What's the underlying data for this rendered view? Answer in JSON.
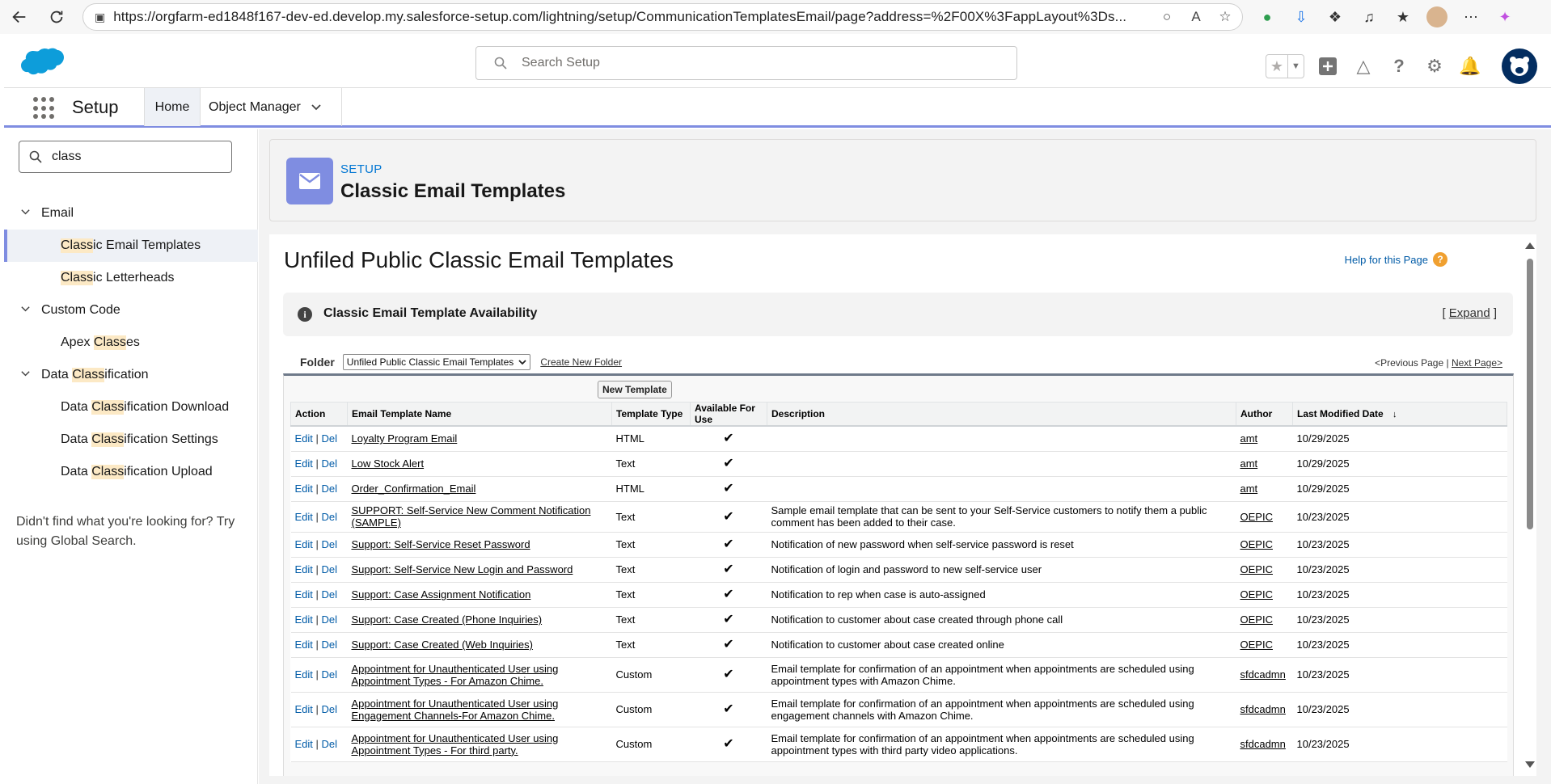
{
  "browser": {
    "url": "https://orgfarm-ed1848f167-dev-ed.develop.my.salesforce-setup.com/lightning/setup/CommunicationTemplatesEmail/page?address=%2F00X%3FappLayout%3Ds..."
  },
  "header": {
    "search_placeholder": "Search Setup"
  },
  "nav": {
    "app_name": "Setup",
    "tabs": [
      {
        "label": "Home"
      },
      {
        "label": "Object Manager"
      }
    ]
  },
  "sidebar": {
    "quickfind_value": "class",
    "groups": [
      {
        "label": "Email",
        "items": [
          {
            "pre": "",
            "hl": "Class",
            "post": "ic Email Templates"
          },
          {
            "pre": "",
            "hl": "Class",
            "post": "ic Letterheads"
          }
        ]
      },
      {
        "label": "Custom Code",
        "items": [
          {
            "pre": "Apex ",
            "hl": "Class",
            "post": "es"
          }
        ]
      },
      {
        "label_pre": "Data ",
        "label_hl": "Class",
        "label_post": "ification",
        "items": [
          {
            "pre": "Data ",
            "hl": "Class",
            "post": "ification Download"
          },
          {
            "pre": "Data ",
            "hl": "Class",
            "post": "ification Settings"
          },
          {
            "pre": "Data ",
            "hl": "Class",
            "post": "ification Upload"
          }
        ]
      }
    ],
    "not_found": "Didn't find what you're looking for? Try using Global Search."
  },
  "page_header": {
    "eyebrow": "SETUP",
    "title": "Classic Email Templates"
  },
  "content": {
    "title": "Unfiled Public Classic Email Templates",
    "help_link": "Help for this Page",
    "availability_title": "Classic Email Template Availability",
    "expand_open": "[ ",
    "expand_label": "Expand",
    "expand_close": " ]",
    "folder_label": "Folder",
    "folder_value": "Unfiled Public Classic Email Templates",
    "create_folder": "Create New Folder",
    "prev_page": "<Previous Page",
    "pager_sep": " | ",
    "next_page": "Next Page>",
    "new_template": "New Template"
  },
  "table": {
    "headers": {
      "action": "Action",
      "name": "Email Template Name",
      "type": "Template Type",
      "available": "Available For Use",
      "description": "Description",
      "author": "Author",
      "modified": "Last Modified Date"
    },
    "edit_label": "Edit",
    "del_label": "Del",
    "rows": [
      {
        "name": "Loyalty Program Email",
        "type": "HTML",
        "available": "✔",
        "description": "",
        "author": "amt",
        "modified": "10/29/2025"
      },
      {
        "name": "Low Stock Alert",
        "type": "Text",
        "available": "✔",
        "description": "",
        "author": "amt",
        "modified": "10/29/2025"
      },
      {
        "name": "Order_Confirmation_Email",
        "type": "HTML",
        "available": "✔",
        "description": "",
        "author": "amt",
        "modified": "10/29/2025"
      },
      {
        "name": "SUPPORT: Self-Service New Comment Notification (SAMPLE)",
        "type": "Text",
        "available": "✔",
        "description": "Sample email template that can be sent to your Self-Service customers to notify them a public comment has been added to their case.",
        "author": "OEPIC",
        "modified": "10/23/2025"
      },
      {
        "name": "Support: Self-Service Reset Password",
        "type": "Text",
        "available": "✔",
        "description": "Notification of new password when self-service password is reset",
        "author": "OEPIC",
        "modified": "10/23/2025"
      },
      {
        "name": "Support: Self-Service New Login and Password",
        "type": "Text",
        "available": "✔",
        "description": "Notification of login and password to new self-service user",
        "author": "OEPIC",
        "modified": "10/23/2025"
      },
      {
        "name": "Support: Case Assignment Notification",
        "type": "Text",
        "available": "✔",
        "description": "Notification to rep when case is auto-assigned",
        "author": "OEPIC",
        "modified": "10/23/2025"
      },
      {
        "name": "Support: Case Created (Phone Inquiries)",
        "type": "Text",
        "available": "✔",
        "description": "Notification to customer about case created through phone call",
        "author": "OEPIC",
        "modified": "10/23/2025"
      },
      {
        "name": "Support: Case Created (Web Inquiries)",
        "type": "Text",
        "available": "✔",
        "description": "Notification to customer about case created online",
        "author": "OEPIC",
        "modified": "10/23/2025"
      },
      {
        "name": "Appointment for Unauthenticated User using Appointment Types - For Amazon Chime.",
        "type": "Custom",
        "available": "✔",
        "description": "Email template for confirmation of an appointment when appointments are scheduled using appointment types with Amazon Chime.",
        "author": "sfdcadmn",
        "modified": "10/23/2025"
      },
      {
        "name": "Appointment for Unauthenticated User using Engagement Channels-For Amazon Chime.",
        "type": "Custom",
        "available": "✔",
        "description": "Email template for confirmation of an appointment when appointments are scheduled using engagement channels with Amazon Chime.",
        "author": "sfdcadmn",
        "modified": "10/23/2025"
      },
      {
        "name": "Appointment for Unauthenticated User using Appointment Types - For third party.",
        "type": "Custom",
        "available": "✔",
        "description": "Email template for confirmation of an appointment when appointments are scheduled using appointment types with third party video applications.",
        "author": "sfdcadmn",
        "modified": "10/23/2025"
      }
    ]
  }
}
